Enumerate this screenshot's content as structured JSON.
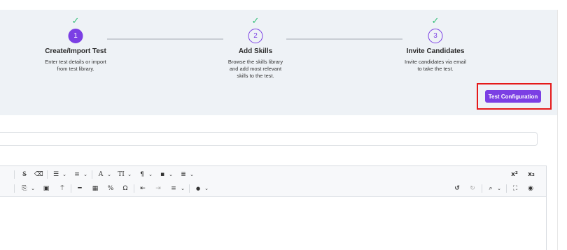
{
  "stepper": {
    "steps": [
      {
        "number": "1",
        "check": "✓",
        "title": "Create/Import Test",
        "desc_line1": "Enter test details or import",
        "desc_line2": "from test library.",
        "desc_line3": "",
        "state": "active"
      },
      {
        "number": "2",
        "check": "✓",
        "title": "Add Skills",
        "desc_line1": "Browse the skills library",
        "desc_line2": "and add most relevant",
        "desc_line3": "skills to the test.",
        "state": "pending"
      },
      {
        "number": "3",
        "check": "✓",
        "title": "Invite Candidates",
        "desc_line1": "Invite candidates via email",
        "desc_line2": "to take the test.",
        "desc_line3": "",
        "state": "pending"
      }
    ]
  },
  "actions": {
    "config_label": "Test Configuration"
  },
  "editor": {
    "row1": {
      "strike": "S̶",
      "eraser": "⌫",
      "bullets": "☰",
      "numbers": "≡",
      "caret": "⌄",
      "font_color": "A",
      "font_size": "TI",
      "paragraph": "¶",
      "block": "▪",
      "align": "≣"
    },
    "row1_right": {
      "superscript": "x²",
      "subscript": "x₂"
    },
    "row2": {
      "paste": "⎘",
      "box": "▣",
      "format_painter": "⍑",
      "hr": "━",
      "table": "▦",
      "link": "%",
      "omega": "Ω",
      "outdent": "⇤",
      "indent": "⇥",
      "line_height": "≡",
      "color_drop": "●"
    },
    "row2_right": {
      "undo": "↺",
      "redo": "↻",
      "find": "⌕",
      "fullscreen": "⛶",
      "preview": "◉"
    }
  },
  "colors": {
    "accent": "#7b3fe4",
    "check": "#35c07a",
    "highlight": "#e51a1a",
    "band": "#eef2f6"
  }
}
